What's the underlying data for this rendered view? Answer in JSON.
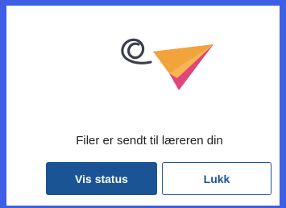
{
  "dialog": {
    "message": "Filer er sendt til læreren din",
    "illustration_icon": "paper-plane-icon",
    "frame_color": "#3d5ee5"
  },
  "buttons": {
    "primary_label": "Vis status",
    "secondary_label": "Lukk",
    "primary_color": "#1a5494"
  }
}
